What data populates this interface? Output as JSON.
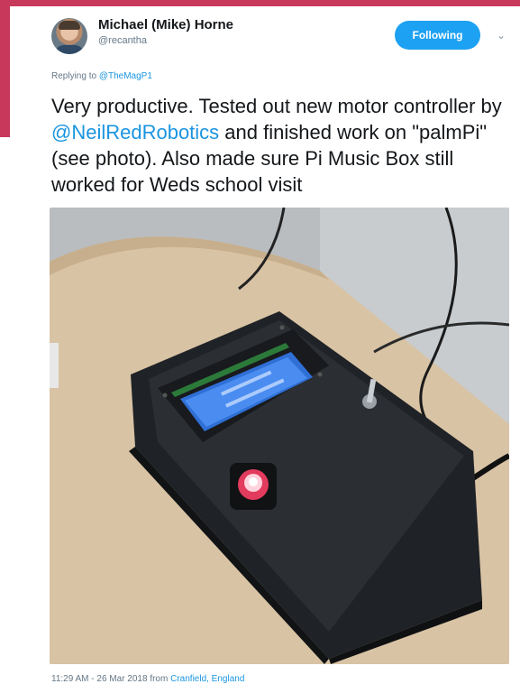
{
  "colors": {
    "accent": "#c8385b",
    "link": "#1b95e0",
    "follow_button": "#1da1f2",
    "secondary_text": "#657786"
  },
  "author": {
    "display_name": "Michael (Mike) Horne",
    "handle": "@recantha",
    "avatar_icon": "profile-photo"
  },
  "actions": {
    "follow_label": "Following",
    "menu_icon": "chevron-down-icon"
  },
  "reply": {
    "prefix": "Replying to ",
    "mention": "@TheMagP1"
  },
  "tweet": {
    "text_before": "Very productive. Tested out new motor controller by ",
    "mention": "@NeilRedRobotics",
    "text_after": " and finished work on \"palmPi\" (see photo). Also made sure Pi Music Box still worked for Weds school visit",
    "photo_icon": "palmpi-device-photo"
  },
  "meta": {
    "time_date": "11:29 AM - 26 Mar 2018 from ",
    "location": "Cranfield, England"
  }
}
